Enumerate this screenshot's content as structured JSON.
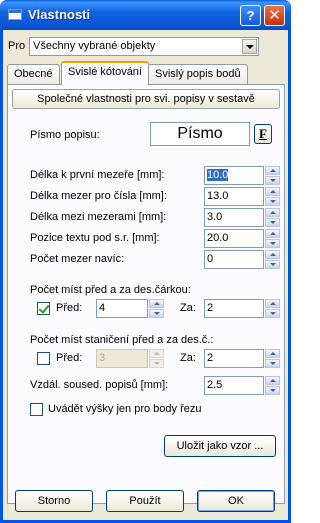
{
  "window": {
    "title": "Vlastnosti",
    "help_glyph": "?",
    "close_glyph": "✕"
  },
  "pro": {
    "label": "Pro",
    "value": "Všechny vybrané objekty"
  },
  "tabs": [
    {
      "label": "Obecné",
      "active": false
    },
    {
      "label": "Svislé kótování",
      "active": true
    },
    {
      "label": "Svislý popis bodů",
      "active": false
    }
  ],
  "panel": {
    "header_button": "Společné vlastnosti pro svi. popisy v sestavě",
    "font": {
      "label": "Písmo popisu:",
      "value": "Písmo",
      "button": "F"
    },
    "fields": [
      {
        "label": "Délka k první mezeře [mm]:",
        "value": "10.0",
        "selected": true
      },
      {
        "label": "Délka mezer pro čísla [mm]:",
        "value": "13.0"
      },
      {
        "label": "Délka mezi mezerami [mm]:",
        "value": "3.0"
      },
      {
        "label": "Pozice textu pod s.r. [mm]:",
        "value": "20.0"
      },
      {
        "label": "Počet mezer navíc:",
        "value": "0"
      }
    ],
    "group1": {
      "title": "Počet míst před a za des.čárkou:",
      "before_label": "Před:",
      "before_value": "4",
      "before_checked": true,
      "after_label": "Za:",
      "after_value": "2"
    },
    "group2": {
      "title": "Počet míst staničení před a za des.č.:",
      "before_label": "Před:",
      "before_value": "3",
      "before_checked": false,
      "after_label": "Za:",
      "after_value": "2"
    },
    "distance": {
      "label": "Vzdál. soused. popisů [mm]:",
      "value": "2.5"
    },
    "only_cuts": {
      "label": "Uvádět výšky jen pro body řezu",
      "checked": false
    },
    "save_template": "Uložit jako vzor ..."
  },
  "footer": {
    "cancel": "Storno",
    "apply": "Použít",
    "ok": "OK"
  }
}
